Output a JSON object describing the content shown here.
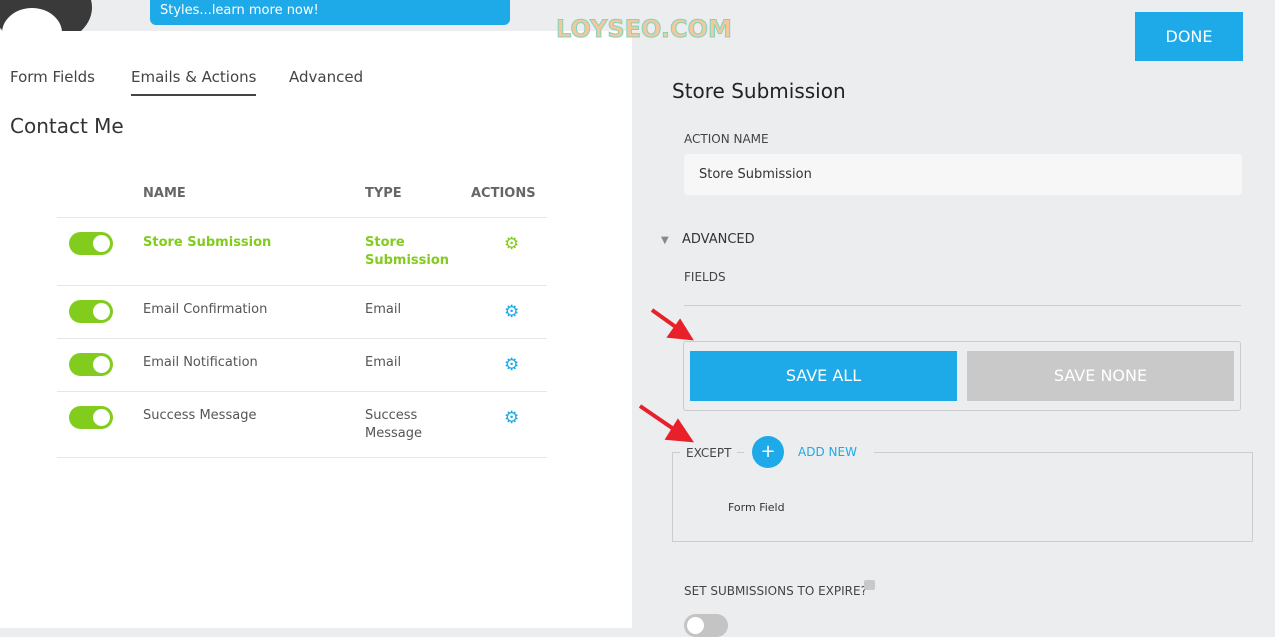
{
  "banner": {
    "text": "Styles...learn more now!"
  },
  "watermark": "LOYSEO.COM",
  "tabs": [
    {
      "label": "Form Fields"
    },
    {
      "label": "Emails & Actions",
      "active": true
    },
    {
      "label": "Advanced"
    }
  ],
  "form_title": "Contact Me",
  "table": {
    "headers": {
      "name": "NAME",
      "type": "TYPE",
      "actions": "ACTIONS"
    },
    "rows": [
      {
        "enabled": true,
        "name": "Store Submission",
        "type_line1": "Store",
        "type_line2": "Submission",
        "active": true
      },
      {
        "enabled": true,
        "name": "Email Confirmation",
        "type_line1": "Email",
        "type_line2": ""
      },
      {
        "enabled": true,
        "name": "Email Notification",
        "type_line1": "Email",
        "type_line2": ""
      },
      {
        "enabled": true,
        "name": "Success Message",
        "type_line1": "Success",
        "type_line2": "Message"
      }
    ]
  },
  "panel": {
    "done": "DONE",
    "title": "Store Submission",
    "action_name_label": "ACTION NAME",
    "action_name_value": "Store Submission",
    "advanced": "ADVANCED",
    "fields": "FIELDS",
    "save_all": "SAVE ALL",
    "save_none": "SAVE NONE",
    "except": "EXCEPT",
    "add_new": "ADD NEW",
    "form_field": "Form Field",
    "expire_label": "SET SUBMISSIONS TO EXPIRE?",
    "expire_enabled": false
  },
  "colors": {
    "accent": "#1ea9e8",
    "green": "#82cc1e",
    "disabled": "#c9c9c9",
    "arrow": "#e8202a"
  }
}
